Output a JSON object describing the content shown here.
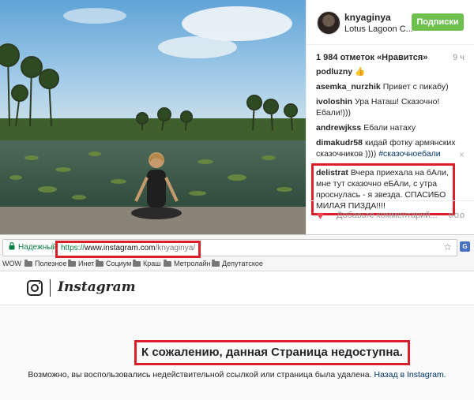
{
  "post": {
    "username": "knyaginya",
    "location": "Lotus Lagoon C...",
    "follow_label": "Подписки",
    "likes": "1 984 отметок «Нравится»",
    "age": "9 ч",
    "comments": [
      {
        "user": "podluzny",
        "text": "👍"
      },
      {
        "user": "asemka_nurzhik",
        "text": "Привет с пикабу)"
      },
      {
        "user": "ivoloshin",
        "text": "Ура Наташ! Сказочно! Ебали!)))"
      },
      {
        "user": "andrewjkss",
        "text": "Ебали натаху"
      },
      {
        "user": "dimakudr58",
        "text": "кидай фотку армянских сказочников )))) ",
        "tag": "#сказочноебали"
      },
      {
        "user": "delistrat",
        "text": "Вчера приехала на бАли, мне тут сказочно еБАли, с утра проснулась - я звезда. СПАСИБО МИЛАЯ ПИЗДА!!!!"
      }
    ],
    "add_comment_placeholder": "Добавьте комментарий...",
    "more_label": "ooo",
    "heart_icon": "heart-icon",
    "close_icon": "×"
  },
  "browser": {
    "secure_label": "Надежный",
    "url_scheme": "https://",
    "url_host": "www.instagram.com",
    "url_path": "/knyaginya/",
    "ext_label": "G",
    "bookmarks": [
      {
        "label": "WOW",
        "folder": false
      },
      {
        "label": "Полезное",
        "folder": true
      },
      {
        "label": "Инет",
        "folder": true
      },
      {
        "label": "Социум",
        "folder": true
      },
      {
        "label": "Краш",
        "folder": true
      },
      {
        "label": "Метролайн",
        "folder": true
      },
      {
        "label": "Депутатское",
        "folder": true
      }
    ]
  },
  "page": {
    "wordmark": "Instagram",
    "error_title": "К сожалению, данная Страница недоступна.",
    "error_text": "Возможно, вы воспользовались недействительной ссылкой или страница была удалена. ",
    "back_link": "Назад в Instagram."
  },
  "colors": {
    "highlight": "#d81f2a",
    "follow_green": "#70c050",
    "link_blue": "#003569",
    "secure_green": "#0b8043"
  }
}
